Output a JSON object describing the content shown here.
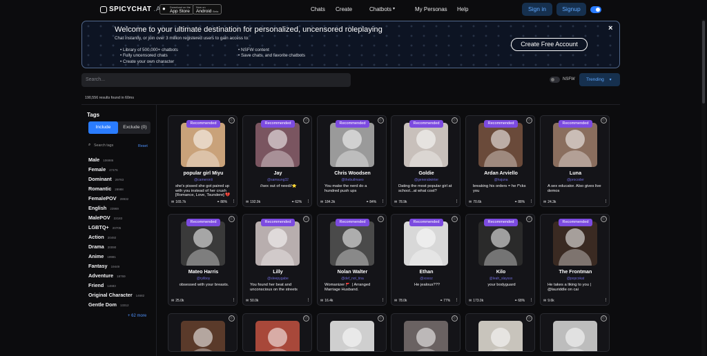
{
  "header": {
    "logo": "SPICYCHAT",
    "logo_suffix": ".AI",
    "app_store_small": "Download on the",
    "app_store": "App Store",
    "android_small": "Now on",
    "android": "Android",
    "android_tag": "Beta",
    "nav": [
      "Chats",
      "Create",
      "Chatbots",
      "My Personas",
      "Help"
    ],
    "sign_in": "Sign in",
    "signup": "Signup"
  },
  "banner": {
    "title": "Welcome to your ultimate destination for personalized, uncensored roleplaying",
    "subtitle": "Chat instantly, or join over 3 million registered users to gain access to:",
    "bullets_left": [
      "Library of 500,000+ chatbots",
      "Fully uncensored chats",
      "Create your own character"
    ],
    "bullets_right": [
      "NSFW content",
      "Save chats, and favorite chatbots"
    ],
    "cta": "Create Free Account",
    "close": "×"
  },
  "search": {
    "placeholder": "Search..."
  },
  "filters": {
    "nsfw": "NSFW",
    "sort": "Trending"
  },
  "results_text": "190,556 results found in 60ms",
  "sidebar": {
    "title": "Tags",
    "include": "Include",
    "exclude": "Exclude (0)",
    "search_placeholder": "Search tags",
    "reset": "Reset",
    "tags": [
      {
        "name": "Male",
        "count": "106986"
      },
      {
        "name": "Female",
        "count": "47476"
      },
      {
        "name": "Dominant",
        "count": "29783"
      },
      {
        "name": "Romantic",
        "count": "28988"
      },
      {
        "name": "FemalePOV",
        "count": "28932"
      },
      {
        "name": "English",
        "count": "23969"
      },
      {
        "name": "MalePOV",
        "count": "22183"
      },
      {
        "name": "LGBTQ+",
        "count": "20705"
      },
      {
        "name": "Action",
        "count": "20492"
      },
      {
        "name": "Drama",
        "count": "20090"
      },
      {
        "name": "Anime",
        "count": "19981"
      },
      {
        "name": "Fantasy",
        "count": "19449"
      },
      {
        "name": "Adventure",
        "count": "18769"
      },
      {
        "name": "Friend",
        "count": "14683"
      },
      {
        "name": "Original Character",
        "count": "14682"
      },
      {
        "name": "Gentle Dom",
        "count": "13312"
      }
    ],
    "more": "+ 62 more"
  },
  "cards_row1": [
    {
      "badge": "Recommended",
      "name": "popular girl Miyu",
      "handle": "@cameronli",
      "desc": "she's pissed she got paired up with you instead of her crush [Romance, Love, Tsundere] 💔",
      "count": "165.7k",
      "pct": "88%",
      "color": "#c9a27a"
    },
    {
      "badge": "Recommended",
      "name": "Jay",
      "handle": "@samsung32",
      "desc": "//sex out of need//⭐",
      "count": "192.9k",
      "pct": "62%",
      "color": "#7a5560"
    },
    {
      "badge": "Recommended",
      "name": "Chris Woodsen",
      "handle": "@thebuilmaeo",
      "desc": "You make the nerd do a hundred push ups",
      "count": "184.3k",
      "pct": "84%",
      "color": "#9a9a9a"
    },
    {
      "badge": "Recommended",
      "name": "Goldie",
      "handle": "@generalwinter",
      "desc": "Dating the most popular girl at school...at what cost?",
      "count": "78.9k",
      "pct": "",
      "color": "#c8c0bb"
    },
    {
      "badge": "Recommended",
      "name": "Ardan Arviello",
      "handle": "@hajuna",
      "desc": "breaking his orders = he f*cks you",
      "count": "70.6k",
      "pct": "88%",
      "color": "#6a4a3a"
    },
    {
      "badge": "Recommended",
      "name": "Luna",
      "handle": "@procoder",
      "desc": "A sex educator. Also gives live demos",
      "count": "24.3k",
      "pct": "",
      "color": "#8a6e5e"
    }
  ],
  "cards_row2": [
    {
      "badge": "Recommended",
      "name": "Mateo Harris",
      "handle": "@ryliboy",
      "desc": "obsessed with your breasts.",
      "count": "25.0k",
      "pct": "",
      "color": "#3a3a3a"
    },
    {
      "badge": "Recommended",
      "name": "Lilly",
      "handle": "@sleepygabe",
      "desc": "You found her beat and unconscious on the streets",
      "count": "50.0k",
      "pct": "",
      "color": "#b8aeae"
    },
    {
      "badge": "Recommended",
      "name": "Nolan Walter",
      "handle": "@def_not_tina",
      "desc": "Womanizer 🚩 | Arranged Marriage Husband.",
      "count": "16.4k",
      "pct": "",
      "color": "#4a4a4a"
    },
    {
      "badge": "Recommended",
      "name": "Ethan",
      "handle": "@xoooz",
      "desc": "He jealous???",
      "count": "78.0k",
      "pct": "77%",
      "color": "#d8d8d8"
    },
    {
      "badge": "Recommended",
      "name": "Kilo",
      "handle": "@leah_slayssx",
      "desc": "your bodyguard",
      "count": "173.0k",
      "pct": "68%",
      "color": "#2a2a2a"
    },
    {
      "badge": "Recommended",
      "name": "The Frontman",
      "handle": "@popcokat",
      "desc": "He takes a liking to you | @lauriddle on cai",
      "count": "9.6k",
      "pct": "",
      "color": "#3a2a22"
    }
  ],
  "cards_row3": [
    {
      "color": "#5a3a2a"
    },
    {
      "color": "#a8483a"
    },
    {
      "color": "#cfcfcf"
    },
    {
      "color": "#6a6262"
    },
    {
      "color": "#c8c4bc"
    },
    {
      "color": "#bdbdbd"
    }
  ],
  "icons": {
    "info": "ⓘ",
    "messages": "✉",
    "rating": "⚭",
    "more": "⋮",
    "search": "⌕"
  }
}
